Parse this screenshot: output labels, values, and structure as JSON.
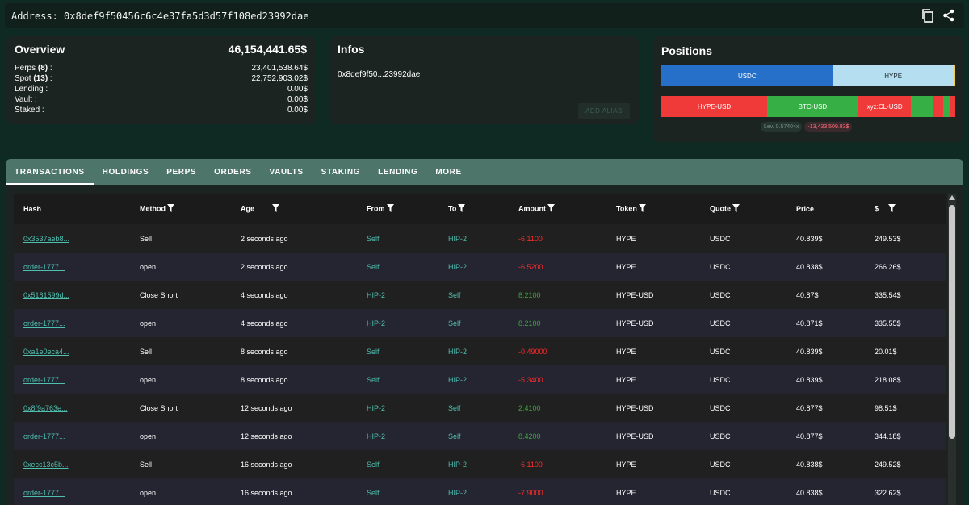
{
  "topbar": {
    "address_label": "Address: 0x8def9f50456c6c4e37fa5d3d57f108ed23992dae"
  },
  "icons": {
    "copy": "copy-icon",
    "share": "share-icon",
    "filter": "filter-icon"
  },
  "overview": {
    "title": "Overview",
    "total": "46,154,441.65$",
    "rows": [
      {
        "label": "Perps",
        "count": "(8)",
        "value": "23,401,538.64$"
      },
      {
        "label": "Spot",
        "count": "(13)",
        "value": "22,752,903.02$"
      },
      {
        "label": "Lending :",
        "count": "",
        "value": "0.00$"
      },
      {
        "label": "Vault :",
        "count": "",
        "value": "0.00$"
      },
      {
        "label": "Staked :",
        "count": "",
        "value": "0.00$"
      }
    ]
  },
  "infos": {
    "title": "Infos",
    "address_short": "0x8def9f50...23992dae",
    "alias_button": "ADD ALIAS"
  },
  "positions": {
    "title": "Positions",
    "spot_bar": [
      {
        "label": "USDC",
        "share": 0.584,
        "color": "#2670c9"
      },
      {
        "label": "HYPE",
        "share": 0.41,
        "color": "#b5dff0"
      },
      {
        "label": "",
        "share": 0.006,
        "color": "#f2c94c"
      }
    ],
    "perp_bar": [
      {
        "label": "HYPE-USD",
        "share": 0.36,
        "color": "#f03a3a"
      },
      {
        "label": "BTC-USD",
        "share": 0.31,
        "color": "#36b044"
      },
      {
        "label": "xyz:CL-USD",
        "share": 0.18,
        "color": "#f03a3a"
      },
      {
        "label": "",
        "share": 0.075,
        "color": "#36b044"
      },
      {
        "label": "",
        "share": 0.035,
        "color": "#f03a3a"
      },
      {
        "label": "",
        "share": 0.02,
        "color": "#36b044"
      },
      {
        "label": "",
        "share": 0.02,
        "color": "#f03a3a"
      }
    ],
    "leverage": "Lev. 0.57404x",
    "pnl": "-13,433,509.83$"
  },
  "tabs": [
    "TRANSACTIONS",
    "HOLDINGS",
    "PERPS",
    "ORDERS",
    "VAULTS",
    "STAKING",
    "LENDING",
    "MORE"
  ],
  "table": {
    "headers": [
      "Hash",
      "Method",
      "Age",
      "From",
      "To",
      "Amount",
      "Token",
      "Quote",
      "Price",
      "$"
    ],
    "rows": [
      {
        "hash": "0x3537aeb8...",
        "method": "Sell",
        "age": "2 seconds ago",
        "from": "Self",
        "to": "HIP-2",
        "amount": "-6.1100",
        "sign": "neg",
        "token": "HYPE",
        "quote": "USDC",
        "price": "40.839$",
        "usd": "249.53$"
      },
      {
        "hash": "order-1777...",
        "method": "open",
        "age": "2 seconds ago",
        "from": "Self",
        "to": "HIP-2",
        "amount": "-6.5200",
        "sign": "neg",
        "token": "HYPE",
        "quote": "USDC",
        "price": "40.838$",
        "usd": "266.26$"
      },
      {
        "hash": "0x5181599d...",
        "method": "Close Short",
        "age": "4 seconds ago",
        "from": "HIP-2",
        "to": "Self",
        "amount": "8.2100",
        "sign": "pos",
        "token": "HYPE-USD",
        "quote": "USDC",
        "price": "40.87$",
        "usd": "335.54$"
      },
      {
        "hash": "order-1777...",
        "method": "open",
        "age": "4 seconds ago",
        "from": "HIP-2",
        "to": "Self",
        "amount": "8.2100",
        "sign": "pos",
        "token": "HYPE-USD",
        "quote": "USDC",
        "price": "40.871$",
        "usd": "335.55$"
      },
      {
        "hash": "0xa1e0eca4...",
        "method": "Sell",
        "age": "8 seconds ago",
        "from": "Self",
        "to": "HIP-2",
        "amount": "-0.49000",
        "sign": "neg",
        "token": "HYPE",
        "quote": "USDC",
        "price": "40.839$",
        "usd": "20.01$"
      },
      {
        "hash": "order-1777...",
        "method": "open",
        "age": "8 seconds ago",
        "from": "Self",
        "to": "HIP-2",
        "amount": "-5.3400",
        "sign": "neg",
        "token": "HYPE",
        "quote": "USDC",
        "price": "40.839$",
        "usd": "218.08$"
      },
      {
        "hash": "0x8f9a763e...",
        "method": "Close Short",
        "age": "12 seconds ago",
        "from": "HIP-2",
        "to": "Self",
        "amount": "2.4100",
        "sign": "pos",
        "token": "HYPE-USD",
        "quote": "USDC",
        "price": "40.877$",
        "usd": "98.51$"
      },
      {
        "hash": "order-1777...",
        "method": "open",
        "age": "12 seconds ago",
        "from": "HIP-2",
        "to": "Self",
        "amount": "8.4200",
        "sign": "pos",
        "token": "HYPE-USD",
        "quote": "USDC",
        "price": "40.877$",
        "usd": "344.18$"
      },
      {
        "hash": "0xecc13c5b...",
        "method": "Sell",
        "age": "16 seconds ago",
        "from": "Self",
        "to": "HIP-2",
        "amount": "-6.1100",
        "sign": "neg",
        "token": "HYPE",
        "quote": "USDC",
        "price": "40.838$",
        "usd": "249.52$"
      },
      {
        "hash": "order-1777...",
        "method": "open",
        "age": "16 seconds ago",
        "from": "Self",
        "to": "HIP-2",
        "amount": "-7.9000",
        "sign": "neg",
        "token": "HYPE",
        "quote": "USDC",
        "price": "40.838$",
        "usd": "322.62$"
      }
    ]
  }
}
